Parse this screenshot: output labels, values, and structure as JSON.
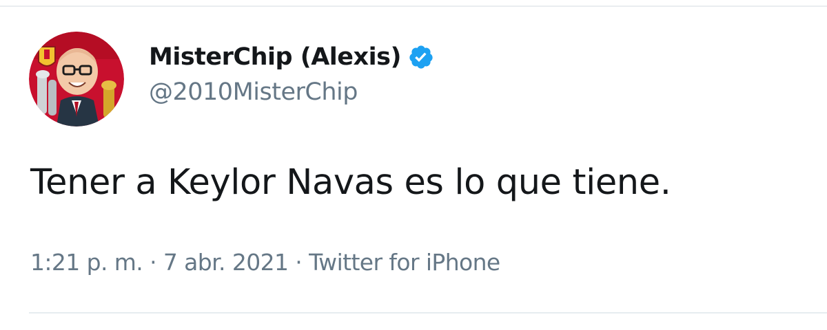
{
  "tweet": {
    "author": {
      "display_name": "MisterChip (Alexis)",
      "handle": "@2010MisterChip",
      "verified": true,
      "avatar_icon": "caricature-avatar-icon",
      "verified_icon": "verified-badge-icon"
    },
    "text": "Tener a Keylor Navas es lo que tiene.",
    "meta": {
      "time": "1:21 p. m.",
      "separator": "·",
      "date": "7 abr. 2021",
      "source": "Twitter for iPhone"
    }
  },
  "colors": {
    "text_primary": "#14171a",
    "text_secondary": "#657786",
    "verified_blue": "#1da1f2",
    "divider": "#e6ecf0"
  }
}
